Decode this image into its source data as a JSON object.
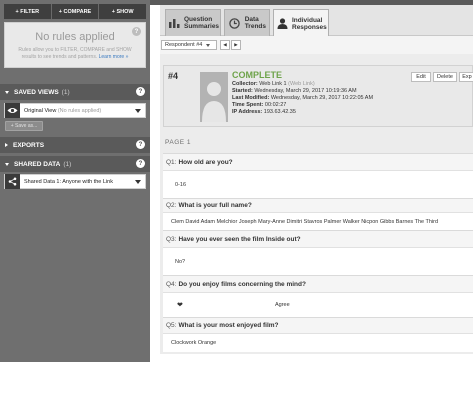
{
  "sidebar": {
    "filter_label": "+ FILTER",
    "compare_label": "+ COMPARE",
    "show_label": "+ SHOW",
    "rules": {
      "title": "No rules applied",
      "description": "Rules allow you to FILTER, COMPARE and SHOW results to see trends and patterns.",
      "learn_more": "Learn more »"
    },
    "saved_views": {
      "title": "SAVED VIEWS",
      "count": "(1)",
      "current_view": "Original View",
      "current_view_note": "(No rules applied)",
      "save_as": "+ Save as..."
    },
    "exports": {
      "title": "EXPORTS"
    },
    "shared_data": {
      "title": "SHARED DATA",
      "count": "(1)",
      "item": "Shared Data 1:",
      "item_note": "Anyone with the Link"
    },
    "help_glyph": "?"
  },
  "tabs": [
    {
      "label_1": "Question",
      "label_2": "Summaries"
    },
    {
      "label_1": "Data",
      "label_2": "Trends"
    },
    {
      "label_1": "Individual",
      "label_2": "Responses"
    }
  ],
  "navbar": {
    "respondent_select": "Respondent #4",
    "prev_glyph": "◀",
    "next_glyph": "▶"
  },
  "response": {
    "number": "#4",
    "status": "COMPLETE",
    "collector_label": "Collector:",
    "collector_value": "Web Link 1",
    "collector_note": "(Web Link)",
    "started_label": "Started:",
    "started_value": "Wednesday, March 29, 2017 10:19:36 AM",
    "modified_label": "Last Modified:",
    "modified_value": "Wednesday, March 29, 2017 10:22:05 AM",
    "time_label": "Time Spent:",
    "time_value": "00:02:27",
    "ip_label": "IP Address:",
    "ip_value": "193.63.42.35",
    "edit_label": "Edit",
    "delete_label": "Delete",
    "export_label": "Exp"
  },
  "page_label": "PAGE 1",
  "questions": [
    {
      "number": "Q1:",
      "text": "How old are you?",
      "answer": "0-16"
    },
    {
      "number": "Q2:",
      "text": "What is your full name?",
      "answer": "Clem David Adam Melchior Joseph Mary-Anne Dimitri Stavros Palmer Walker Nicpon Gibbs Barnes The Third"
    },
    {
      "number": "Q3:",
      "text": "Have you ever seen the film Inside out?",
      "answer": "No?"
    },
    {
      "number": "Q4:",
      "text": "Do you enjoy films concerning the mind?",
      "answer_icon": "❤",
      "answer": "Agree"
    },
    {
      "number": "Q5:",
      "text": "What is your most enjoyed film?",
      "answer": "Clockwork Orange"
    }
  ],
  "colors": {
    "sidebar_bg": "#6f6f6f",
    "complete_green": "#6ea34a",
    "link_blue": "#3a7ac0"
  }
}
